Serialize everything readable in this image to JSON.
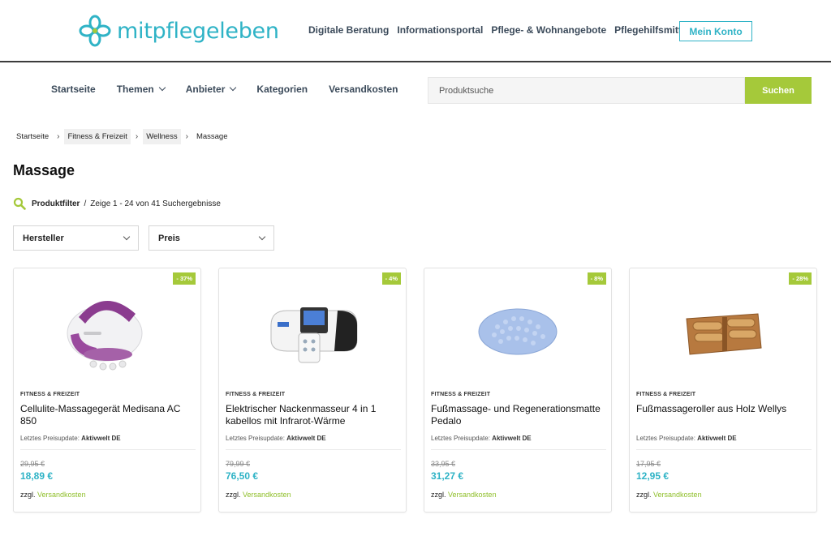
{
  "header": {
    "logo_text": "mitpflegeleben",
    "nav": [
      "Digitale Beratung",
      "Informationsportal",
      "Pflege- & Wohnangebote",
      "Pflegehilfsmittel"
    ],
    "account_button": "Mein Konto"
  },
  "mainnav": {
    "items": [
      {
        "label": "Startseite",
        "dropdown": false
      },
      {
        "label": "Themen",
        "dropdown": true
      },
      {
        "label": "Anbieter",
        "dropdown": true
      },
      {
        "label": "Kategorien",
        "dropdown": false
      },
      {
        "label": "Versandkosten",
        "dropdown": false
      }
    ]
  },
  "search": {
    "placeholder": "Produktsuche",
    "button": "Suchen"
  },
  "breadcrumb": [
    "Startseite",
    "Fitness & Freizeit",
    "Wellness",
    "Massage"
  ],
  "page_title": "Massage",
  "filter": {
    "label": "Produktfilter",
    "separator": "/",
    "results": "Zeige 1 - 24 von 41 Suchergebnisse"
  },
  "dropdowns": {
    "manufacturer": "Hersteller",
    "price": "Preis"
  },
  "colors": {
    "brand_teal": "#2fb3c6",
    "accent_green": "#a5c93a"
  },
  "products": [
    {
      "badge": "- 37%",
      "category": "FITNESS & FREIZEIT",
      "name": "Cellulite-Massagegerät Medisana AC 850",
      "update_label": "Letztes Preisupdate:",
      "update_source": "Aktivwelt DE",
      "old_price": "29,95 €",
      "price": "18,89 €",
      "shipping_prefix": "zzgl.",
      "shipping_link": "Versandkosten",
      "icon": "cellulite-massager-image"
    },
    {
      "badge": "- 4%",
      "category": "FITNESS & FREIZEIT",
      "name": "Elektrischer Nackenmasseur 4 in 1 kabellos mit Infrarot-Wärme",
      "update_label": "Letztes Preisupdate:",
      "update_source": "Aktivwelt DE",
      "old_price": "79,99 €",
      "price": "76,50 €",
      "shipping_prefix": "zzgl.",
      "shipping_link": "Versandkosten",
      "icon": "neck-massager-image"
    },
    {
      "badge": "- 8%",
      "category": "FITNESS & FREIZEIT",
      "name": "Fußmassage- und Regenerationsmatte Pedalo",
      "update_label": "Letztes Preisupdate:",
      "update_source": "Aktivwelt DE",
      "old_price": "33,95 €",
      "price": "31,27 €",
      "shipping_prefix": "zzgl.",
      "shipping_link": "Versandkosten",
      "icon": "foot-massage-mat-image"
    },
    {
      "badge": "- 28%",
      "category": "FITNESS & FREIZEIT",
      "name": "Fußmassageroller aus Holz Wellys",
      "update_label": "Letztes Preisupdate:",
      "update_source": "Aktivwelt DE",
      "old_price": "17,95 €",
      "price": "12,95 €",
      "shipping_prefix": "zzgl.",
      "shipping_link": "Versandkosten",
      "icon": "wooden-foot-roller-image"
    }
  ]
}
